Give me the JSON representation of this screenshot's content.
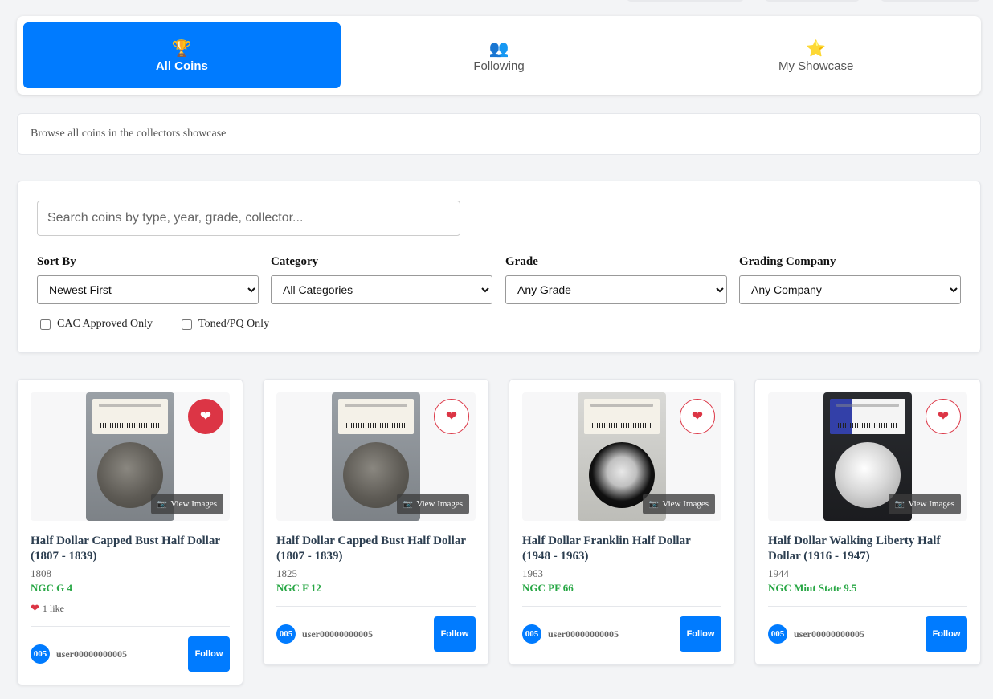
{
  "tabs": [
    {
      "label": "All Coins",
      "icon": "trophy-icon",
      "glyph": "🏆",
      "active": true
    },
    {
      "label": "Following",
      "icon": "people-icon",
      "glyph": "👥",
      "active": false
    },
    {
      "label": "My Showcase",
      "icon": "star-icon",
      "glyph": "⭐",
      "active": false
    }
  ],
  "description": "Browse all coins in the collectors showcase",
  "search": {
    "placeholder": "Search coins by type, year, grade, collector...",
    "value": ""
  },
  "filters": {
    "sort": {
      "label": "Sort By",
      "value": "Newest First"
    },
    "category": {
      "label": "Category",
      "value": "All Categories"
    },
    "grade": {
      "label": "Grade",
      "value": "Any Grade"
    },
    "company": {
      "label": "Grading Company",
      "value": "Any Company"
    }
  },
  "checkboxes": [
    {
      "label": "CAC Approved Only",
      "checked": false
    },
    {
      "label": "Toned/PQ Only",
      "checked": false
    }
  ],
  "view_images_label": "View Images",
  "follow_label": "Follow",
  "coins": [
    {
      "title": "Half Dollar Capped Bust Half Dollar (1807 - 1839)",
      "year": "1808",
      "grade": "NGC G 4",
      "likes": "1 like",
      "favorited": true,
      "user": "user00000000005",
      "avatar": "005"
    },
    {
      "title": "Half Dollar Capped Bust Half Dollar (1807 - 1839)",
      "year": "1825",
      "grade": "NGC F 12",
      "likes": "",
      "favorited": false,
      "user": "user00000000005",
      "avatar": "005"
    },
    {
      "title": "Half Dollar Franklin Half Dollar (1948 - 1963)",
      "year": "1963",
      "grade": "NGC PF 66",
      "likes": "",
      "favorited": false,
      "user": "user00000000005",
      "avatar": "005"
    },
    {
      "title": "Half Dollar Walking Liberty Half Dollar (1916 - 1947)",
      "year": "1944",
      "grade": "NGC Mint State 9.5",
      "likes": "",
      "favorited": false,
      "user": "user00000000005",
      "avatar": "005"
    }
  ]
}
